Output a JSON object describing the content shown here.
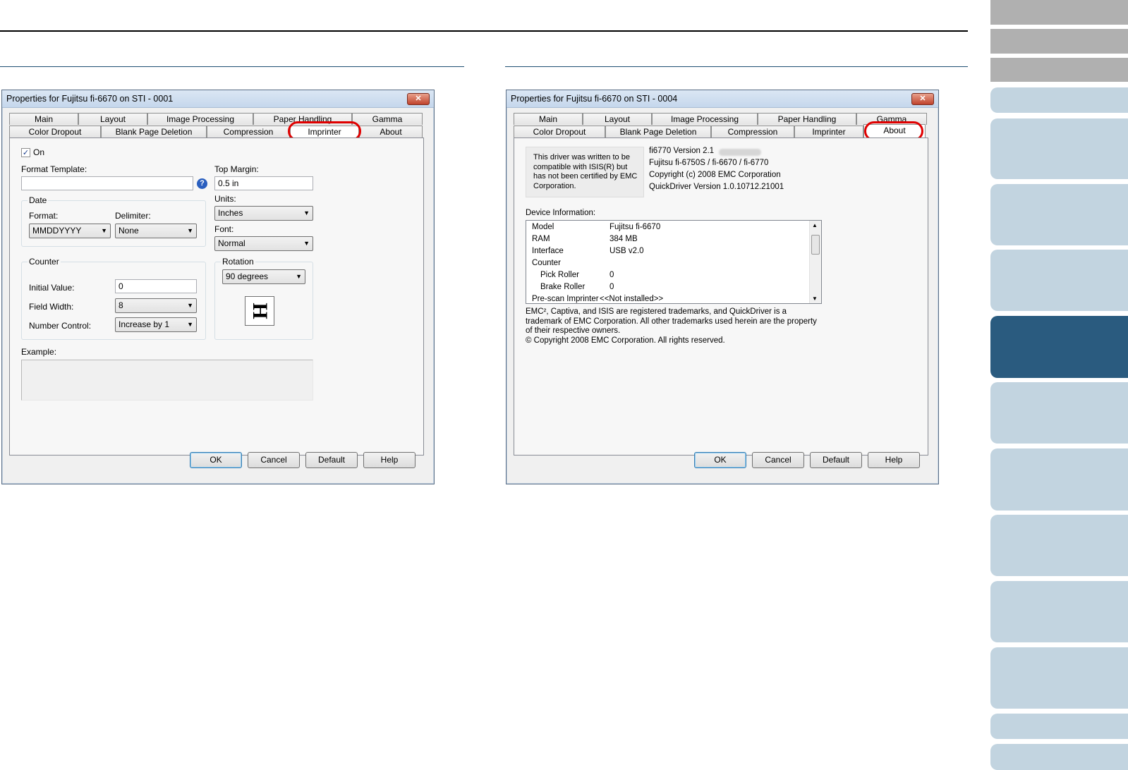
{
  "side_nav": {
    "tabs": [
      "",
      "",
      "",
      "",
      "",
      "",
      "",
      "",
      "",
      "",
      "",
      "",
      "",
      "",
      ""
    ]
  },
  "dialog1": {
    "title": "Properties for Fujitsu fi-6670 on STI - 0001",
    "tabs_back": [
      "Main",
      "Layout",
      "Image Processing",
      "Paper Handling",
      "Gamma"
    ],
    "tabs_front": [
      "Color Dropout",
      "Blank Page Deletion",
      "Compression",
      "Imprinter",
      "About"
    ],
    "on_label": "On",
    "format_template_label": "Format Template:",
    "format_template_value": "",
    "top_margin_label": "Top Margin:",
    "top_margin_value": "0.5 in",
    "units_label": "Units:",
    "units_value": "Inches",
    "font_label": "Font:",
    "font_value": "Normal",
    "date_group": "Date",
    "format_label": "Format:",
    "format_value": "MMDDYYYY",
    "delimiter_label": "Delimiter:",
    "delimiter_value": "None",
    "counter_group": "Counter",
    "initial_value_label": "Initial Value:",
    "initial_value": "0",
    "field_width_label": "Field Width:",
    "field_width_value": "8",
    "number_control_label": "Number Control:",
    "number_control_value": "Increase by 1",
    "rotation_group": "Rotation",
    "rotation_value": "90 degrees",
    "rotation_glyph": "H",
    "example_label": "Example:",
    "buttons": [
      "OK",
      "Cancel",
      "Default",
      "Help"
    ]
  },
  "dialog2": {
    "title": "Properties for Fujitsu fi-6670 on STI - 0004",
    "tabs_back": [
      "Main",
      "Layout",
      "Image Processing",
      "Paper Handling",
      "Gamma"
    ],
    "tabs_front": [
      "Color Dropout",
      "Blank Page Deletion",
      "Compression",
      "Imprinter",
      "About"
    ],
    "notice": "This driver was written to be compatible with ISIS(R) but has not been certified by EMC Corporation.",
    "version_lines": [
      "fi6770 Version 2.1",
      "Fujitsu fi-6750S / fi-6670 / fi-6770",
      "Copyright (c) 2008 EMC Corporation",
      "QuickDriver Version 1.0.10712.21001"
    ],
    "device_info_label": "Device Information:",
    "device_rows": [
      {
        "k": "Model",
        "v": "Fujitsu fi-6670"
      },
      {
        "k": "RAM",
        "v": "384 MB"
      },
      {
        "k": "Interface",
        "v": "USB v2.0"
      },
      {
        "k": "Counter",
        "v": ""
      },
      {
        "k": "Pick Roller",
        "v": "0"
      },
      {
        "k": "Brake Roller",
        "v": "0"
      },
      {
        "k": "Pre-scan Imprinter",
        "v": "<<Not installed>>"
      }
    ],
    "trademark_text": "EMC², Captiva, and ISIS are registered trademarks, and QuickDriver is a trademark of EMC Corporation.  All other trademarks used herein are the property of their respective owners.",
    "copyright_text": "© Copyright 2008 EMC Corporation.  All rights reserved.",
    "buttons": [
      "OK",
      "Cancel",
      "Default",
      "Help"
    ]
  },
  "colors": {
    "active_tab": "#2a5b7f",
    "side_tab": "#c2d4e0",
    "highlight": "#e00000"
  }
}
